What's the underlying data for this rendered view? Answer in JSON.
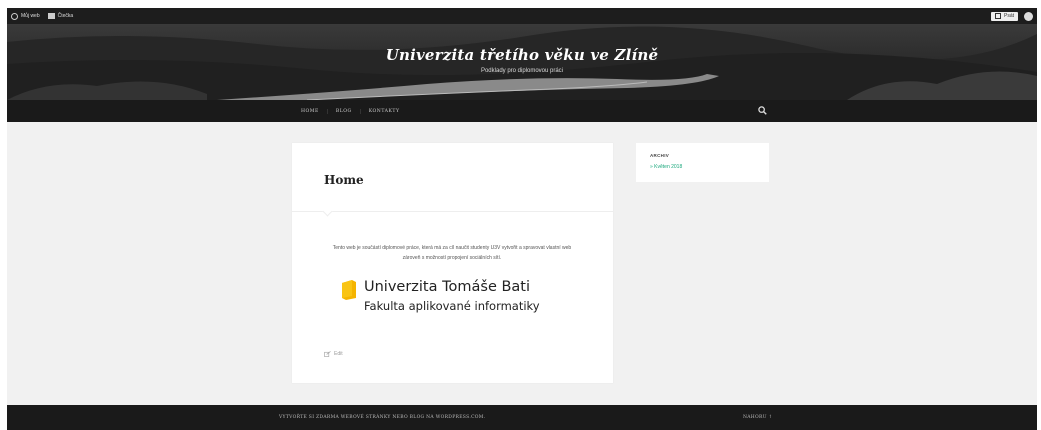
{
  "admin_bar": {
    "site_label": "Můj web",
    "reader_label": "Čtečka",
    "post_label": "Psát"
  },
  "header": {
    "site_title": "Univerzita třetího věku ve Zlíně",
    "site_description": "Podklady pro diplomovou práci"
  },
  "nav": {
    "items": [
      {
        "label": "HOME"
      },
      {
        "label": "BLOG"
      },
      {
        "label": "KONTAKTY"
      }
    ]
  },
  "main": {
    "page_title": "Home",
    "body_text": "Tento web je součástí diplomové práce, která má za cíl naučit studenty U3V vytvořit a spravovat vlastní web zároveň s možností propojení sociálních sítí.",
    "logo": {
      "line1": "Univerzita Tomáše Bati",
      "line2": "Fakulta aplikované informatiky",
      "flag_color": "#f5b400"
    },
    "edit_label": "Edit"
  },
  "sidebar": {
    "widget_title": "ARCHIV",
    "archive_link": "» Květen 2018"
  },
  "footer": {
    "credit": "VYTVOŘTE SI ZDARMA WEBOVÉ STRÁNKY NEBO BLOG NA WORDPRESS.COM.",
    "back_to_top": "NAHORU ↑"
  },
  "colors": {
    "accent": "#1aa87c",
    "nav_bg": "#1a1a1a",
    "admin_bg": "#1d1d1d",
    "page_bg": "#f1f1f1"
  }
}
